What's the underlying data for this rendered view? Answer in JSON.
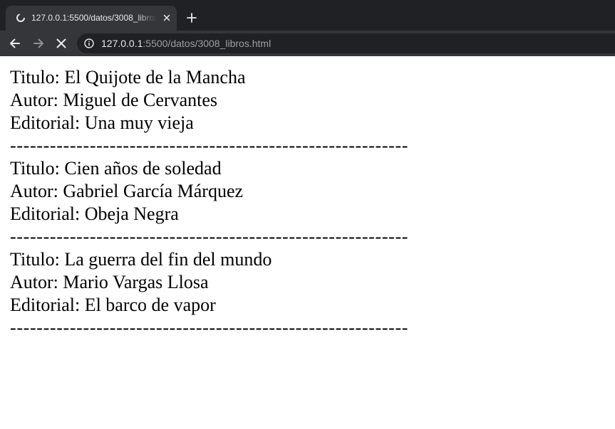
{
  "browser": {
    "tab": {
      "title": "127.0.0.1:5500/datos/3008_libros.html",
      "favicon_icon": "loading-spinner-icon",
      "close_icon": "close-icon"
    },
    "new_tab_icon": "plus-icon",
    "nav": {
      "back_icon": "arrow-left-icon",
      "forward_icon": "arrow-right-icon",
      "stop_icon": "stop-x-icon"
    },
    "address_bar": {
      "info_icon": "info-icon",
      "host": "127.0.0.1",
      "rest": ":5500/datos/3008_libros.html"
    },
    "colors": {
      "tabbar": "#202124",
      "toolbar": "#35363a",
      "url_host": "#e8eaed",
      "url_rest": "#9aa0a6"
    }
  },
  "page": {
    "books": [
      {
        "titulo": "Titulo: El Quijote de la Mancha",
        "autor": "Autor: Miguel de Cervantes",
        "editorial": "Editorial: Una muy vieja",
        "separator": "------------------------------------------------------------"
      },
      {
        "titulo": "Titulo: Cien años de soledad",
        "autor": "Autor: Gabriel García Márquez",
        "editorial": "Editorial: Obeja Negra",
        "separator": "------------------------------------------------------------"
      },
      {
        "titulo": "Titulo: La guerra del fin del mundo",
        "autor": "Autor: Mario Vargas Llosa",
        "editorial": "Editorial: El barco de vapor",
        "separator": "------------------------------------------------------------"
      }
    ]
  }
}
